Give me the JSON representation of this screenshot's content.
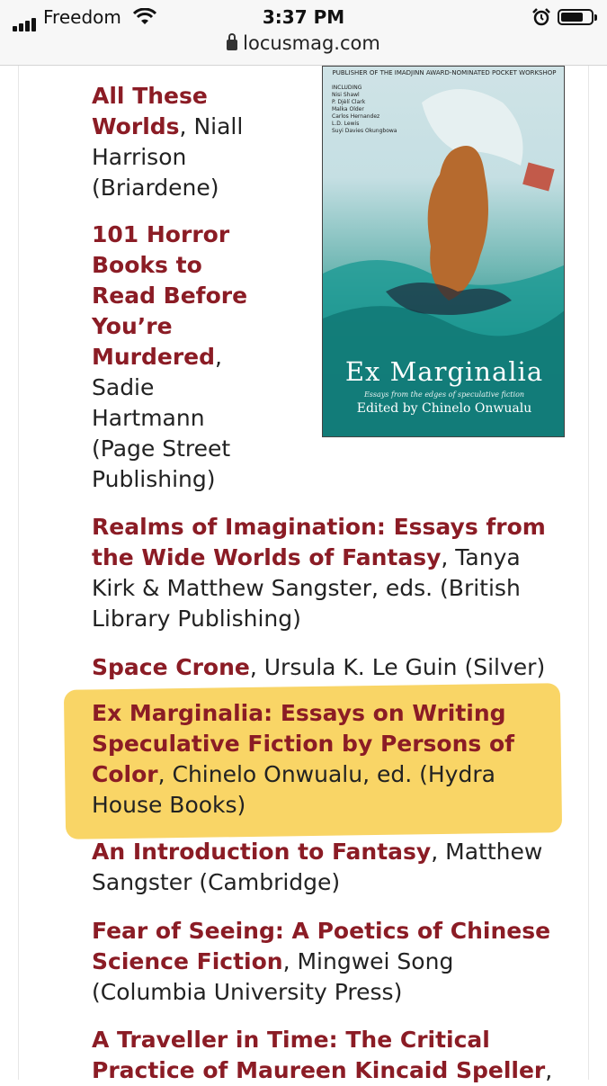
{
  "status_bar": {
    "carrier": "Freedom",
    "time": "3:37 PM",
    "url": "locusmag.com"
  },
  "cover": {
    "publisher_line": "PUBLISHER OF THE IMADJINN AWARD-NOMINATED POCKET WORKSHOP",
    "including_label": "INCLUDING",
    "contributors": [
      "Nisi Shawl",
      "P. Djèlí Clark",
      "Malka Older",
      "Carlos Hernandez",
      "L.D. Lewis",
      "Suyi Davies Okungbowa"
    ],
    "title": "Ex Marginalia",
    "subtitle": "Essays from the edges of speculative fiction",
    "editor_line": "Edited by Chinelo Onwualu"
  },
  "items": [
    {
      "title": "All These Worlds",
      "rest": ", Niall Harrison (Briardene)"
    },
    {
      "title": "101 Horror Books to Read Before You’re Murdered",
      "rest": ", Sadie Hartmann (Page Street Publishing)"
    },
    {
      "title": "Realms of Imagination: Essays from the Wide Worlds of Fantasy",
      "rest": ", Tanya Kirk & Matthew Sangster, eds. (British Library Publishing)"
    },
    {
      "title": "Space Crone",
      "rest": ", Ursula K. Le Guin (Silver)"
    },
    {
      "title": "Ex Marginalia: Essays on Writing Speculative Fiction by Persons of Color",
      "rest": ", Chinelo Onwualu, ed. (Hydra House Books)"
    },
    {
      "title": "An Introduction to Fantasy",
      "rest": ", Matthew Sangster (Cambridge)"
    },
    {
      "title": "Fear of Seeing: A Poetics of Chinese Science Fiction",
      "rest": ", Mingwei Song (Columbia University Press)"
    },
    {
      "title": "A Traveller in Time: The Critical Practice of Maureen Kincaid Speller",
      "rest": ","
    }
  ],
  "colors": {
    "link": "#8b1c25",
    "highlight": "#f9d566"
  }
}
